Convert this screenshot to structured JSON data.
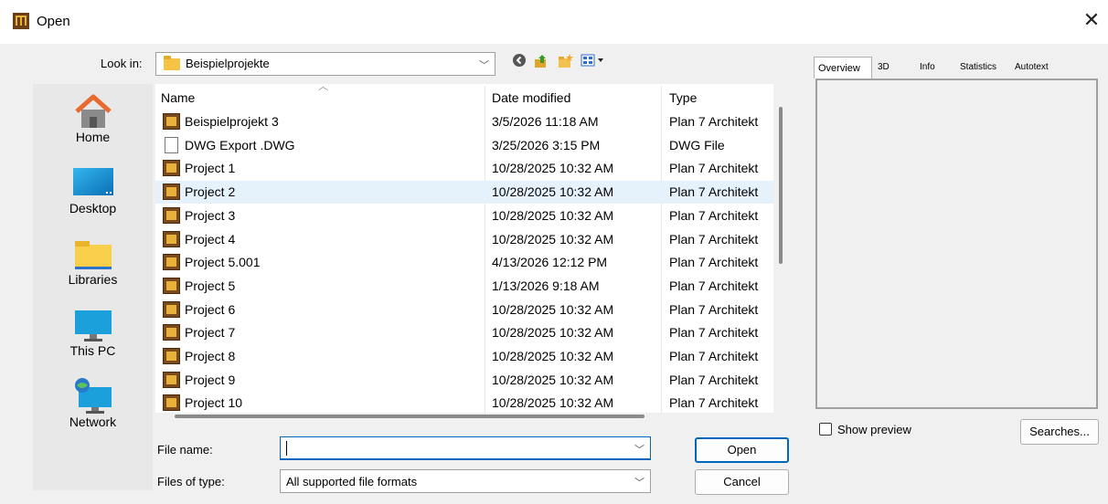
{
  "window": {
    "title": "Open",
    "close_glyph": "✕"
  },
  "look_in": {
    "label": "Look in:",
    "value": "Beispielprojekte"
  },
  "places": [
    {
      "label": "Home",
      "icon": "home-icon"
    },
    {
      "label": "Desktop",
      "icon": "desktop-icon"
    },
    {
      "label": "Libraries",
      "icon": "libraries-icon"
    },
    {
      "label": "This PC",
      "icon": "this-pc-icon"
    },
    {
      "label": "Network",
      "icon": "network-icon"
    }
  ],
  "columns": {
    "name": "Name",
    "date": "Date modified",
    "type": "Type"
  },
  "files": [
    {
      "name": "Beispielprojekt 3",
      "date": "3/5/2026 11:18 AM",
      "type": "Plan 7 Architekt",
      "icon": "plan7-icon"
    },
    {
      "name": "DWG Export .DWG",
      "date": "3/25/2026 3:15 PM",
      "type": "DWG File",
      "icon": "document-icon"
    },
    {
      "name": "Project 1",
      "date": "10/28/2025 10:32 AM",
      "type": "Plan 7 Architekt",
      "icon": "plan7-icon"
    },
    {
      "name": "Project 2",
      "date": "10/28/2025 10:32 AM",
      "type": "Plan 7 Architekt",
      "icon": "plan7-icon",
      "selected": true
    },
    {
      "name": "Project 3",
      "date": "10/28/2025 10:32 AM",
      "type": "Plan 7 Architekt",
      "icon": "plan7-icon"
    },
    {
      "name": "Project 4",
      "date": "10/28/2025 10:32 AM",
      "type": "Plan 7 Architekt",
      "icon": "plan7-icon"
    },
    {
      "name": "Project 5.001",
      "date": "4/13/2026 12:12 PM",
      "type": "Plan 7 Architekt",
      "icon": "plan7-icon"
    },
    {
      "name": "Project 5",
      "date": "1/13/2026 9:18 AM",
      "type": "Plan 7 Architekt",
      "icon": "plan7-icon"
    },
    {
      "name": "Project 6",
      "date": "10/28/2025 10:32 AM",
      "type": "Plan 7 Architekt",
      "icon": "plan7-icon"
    },
    {
      "name": "Project 7",
      "date": "10/28/2025 10:32 AM",
      "type": "Plan 7 Architekt",
      "icon": "plan7-icon"
    },
    {
      "name": "Project 8",
      "date": "10/28/2025 10:32 AM",
      "type": "Plan 7 Architekt",
      "icon": "plan7-icon"
    },
    {
      "name": "Project 9",
      "date": "10/28/2025 10:32 AM",
      "type": "Plan 7 Architekt",
      "icon": "plan7-icon"
    },
    {
      "name": "Project 10",
      "date": "10/28/2025 10:32 AM",
      "type": "Plan 7 Architekt",
      "icon": "plan7-icon"
    }
  ],
  "file_name": {
    "label": "File name:",
    "value": ""
  },
  "file_type": {
    "label": "Files of type:",
    "value": "All supported file formats"
  },
  "buttons": {
    "open": "Open",
    "cancel": "Cancel",
    "searches": "Searches..."
  },
  "preview": {
    "tabs": [
      "Overview",
      "3D",
      "Info",
      "Statistics",
      "Autotext"
    ],
    "show_preview_label": "Show preview"
  }
}
